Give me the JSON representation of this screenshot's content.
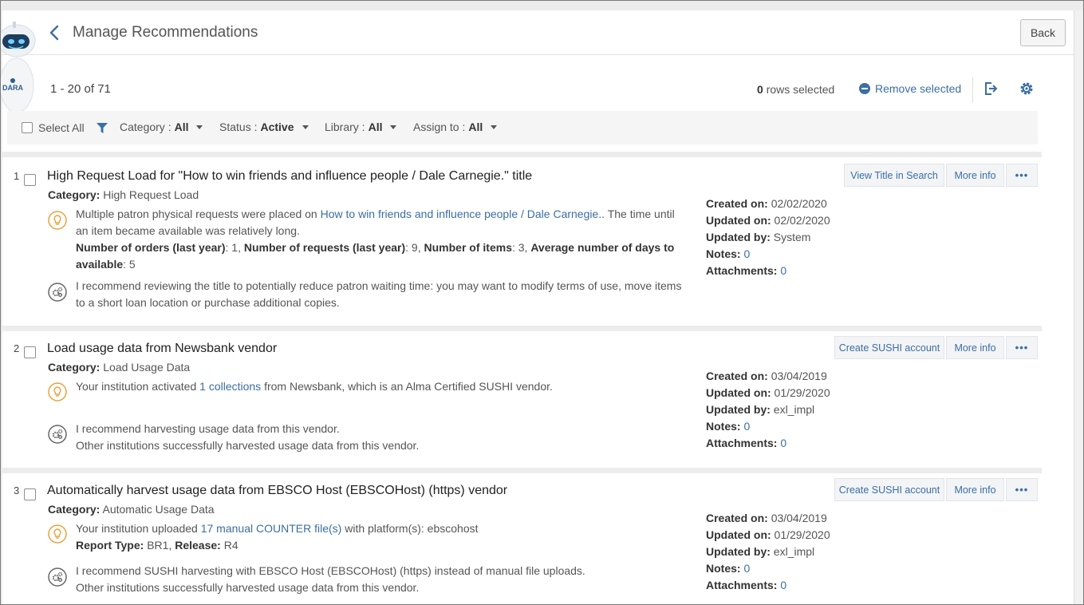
{
  "header": {
    "title": "Manage Recommendations",
    "back_label": "Back",
    "mascot_label": "DARA"
  },
  "toolbar": {
    "count": "1 - 20 of 71",
    "rows_selected_count": "0",
    "rows_selected_text": "rows selected",
    "remove_selected": "Remove selected"
  },
  "filters": {
    "select_all": "Select All",
    "category_label": "Category :",
    "category_value": "All",
    "status_label": "Status :",
    "status_value": "Active",
    "library_label": "Library :",
    "library_value": "All",
    "assign_label": "Assign to :",
    "assign_value": "All"
  },
  "labels": {
    "category": "Category:",
    "created_on": "Created on:",
    "updated_on": "Updated on:",
    "updated_by": "Updated by:",
    "notes": "Notes:",
    "attachments": "Attachments:",
    "more_info": "More info",
    "more_actions": "•••"
  },
  "items": [
    {
      "num": "1",
      "title": "High Request Load for \"How to win friends and influence people / Dale Carnegie.\" title",
      "category": "High Request Load",
      "action_label": "View Title in Search",
      "insight_pre": "Multiple patron physical requests were placed on ",
      "insight_link": "How to win friends and influence people / Dale Carnegie.",
      "insight_post": ". The time until an item became available was relatively long.",
      "orders_label": "Number of orders (last year)",
      "orders_value": ": 1, ",
      "requests_label": "Number of requests (last year)",
      "requests_value": ": 9, ",
      "items_label": "Number of items",
      "items_value": ": 3, ",
      "avg_label": "Average number of days to available",
      "avg_value": ": 5",
      "recommend": "I recommend reviewing the title to potentially reduce patron waiting time: you may want to modify terms of use, move items to a short loan location or purchase additional copies.",
      "created_on": "02/02/2020",
      "updated_on": "02/02/2020",
      "updated_by": "System",
      "notes": "0",
      "attachments": "0"
    },
    {
      "num": "2",
      "title": "Load usage data from Newsbank vendor",
      "category": "Load Usage Data",
      "action_label": "Create SUSHI account",
      "insight_pre": "Your institution activated ",
      "insight_link": "1 collections",
      "insight_post": " from Newsbank, which is an Alma Certified SUSHI vendor.",
      "recommend_1": "I recommend harvesting usage data from this vendor.",
      "recommend_2": "Other institutions successfully harvested usage data from this vendor.",
      "created_on": "03/04/2019",
      "updated_on": "01/29/2020",
      "updated_by": "exl_impl",
      "notes": "0",
      "attachments": "0"
    },
    {
      "num": "3",
      "title": "Automatically harvest usage data from EBSCO Host (EBSCOHost) (https) vendor",
      "category": "Automatic Usage Data",
      "action_label": "Create SUSHI account",
      "insight_pre": "Your institution uploaded ",
      "insight_link": "17 manual COUNTER file(s)",
      "insight_post": " with platform(s): ebscohost",
      "report_type_label": "Report Type:",
      "report_type_value": " BR1, ",
      "release_label": "Release:",
      "release_value": " R4",
      "recommend_1": "I recommend SUSHI harvesting with EBSCO Host (EBSCOHost) (https) instead of manual file uploads.",
      "recommend_2": "Other institutions successfully harvested usage data from this vendor.",
      "created_on": "03/04/2019",
      "updated_on": "01/29/2020",
      "updated_by": "exl_impl",
      "notes": "0",
      "attachments": "0"
    }
  ],
  "colors": {
    "accent": "#3a6ea5",
    "bulb": "#e8a33d",
    "panel": "#ffffff",
    "band": "#ececec"
  }
}
